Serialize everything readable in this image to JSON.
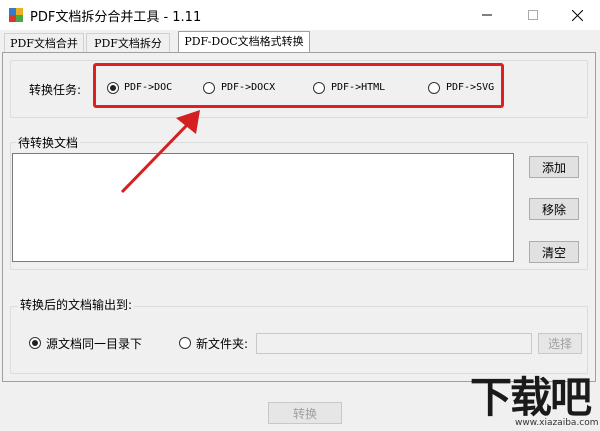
{
  "window": {
    "title": "PDF文档拆分合并工具 - 1.11"
  },
  "tabs": [
    {
      "label": "PDF文档合并"
    },
    {
      "label": "PDF文档拆分"
    },
    {
      "label": "PDF-DOC文档格式转换"
    }
  ],
  "task": {
    "label": "转换任务:",
    "options": [
      {
        "label": "PDF->DOC",
        "selected": true
      },
      {
        "label": "PDF->DOCX",
        "selected": false
      },
      {
        "label": "PDF->HTML",
        "selected": false
      },
      {
        "label": "PDF->SVG",
        "selected": false
      }
    ]
  },
  "pending": {
    "label": "待转换文档",
    "add_label": "添加",
    "remove_label": "移除",
    "clear_label": "清空"
  },
  "output": {
    "label": "转换后的文档输出到:",
    "same_dir_label": "源文档同一目录下",
    "new_folder_label": "新文件夹:",
    "folder_value": "",
    "select_label": "选择"
  },
  "actions": {
    "convert_label": "转换"
  },
  "watermark": {
    "text": "下载吧",
    "sub": "www.xiazaiba.com"
  },
  "colors": {
    "highlight": "#e02020",
    "arrow": "#d42020"
  }
}
